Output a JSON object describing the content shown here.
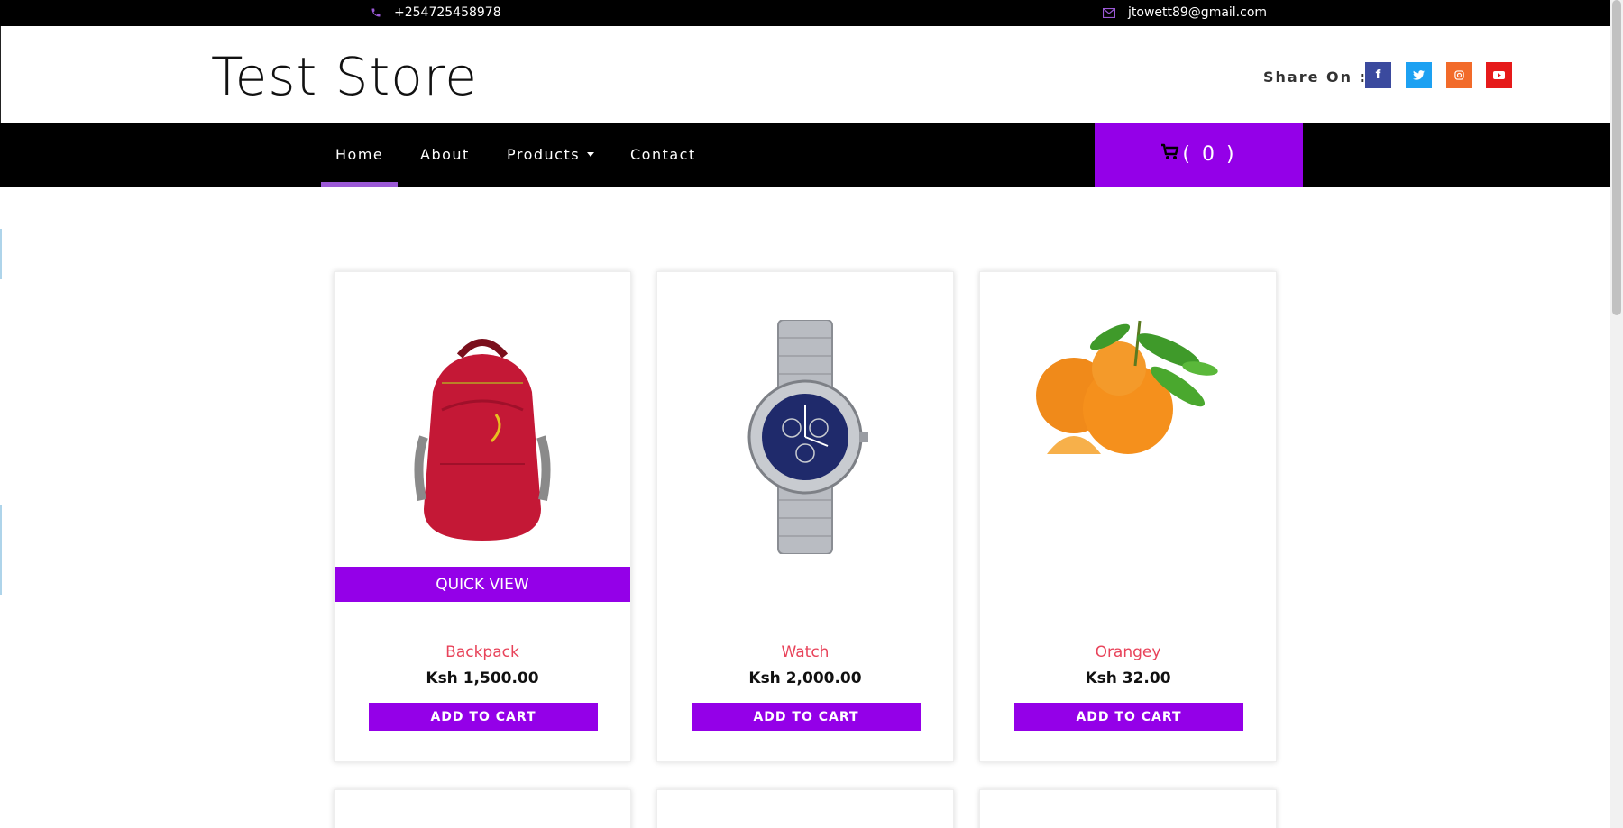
{
  "topbar": {
    "phone": "+254725458978",
    "email": "jtowett89@gmail.com"
  },
  "header": {
    "logo": "Test Store",
    "share_label": "Share On :",
    "social": [
      "facebook-icon",
      "twitter-icon",
      "instagram-icon",
      "youtube-icon"
    ]
  },
  "nav": {
    "items": [
      {
        "label": "Home",
        "active": true
      },
      {
        "label": "About"
      },
      {
        "label": "Products"
      },
      {
        "label": "Contact"
      }
    ],
    "cart_label": "( 0 )"
  },
  "products": [
    {
      "name": "Backpack",
      "price": "Ksh 1,500.00",
      "quick_view": "QUICK VIEW",
      "add_label": "ADD TO CART",
      "icon": "backpack-image"
    },
    {
      "name": "Watch",
      "price": "Ksh 2,000.00",
      "add_label": "ADD TO CART",
      "icon": "watch-image"
    },
    {
      "name": "Orangey",
      "price": "Ksh 32.00",
      "add_label": "ADD TO CART",
      "icon": "oranges-image"
    }
  ],
  "colors": {
    "accent": "#9400e8",
    "product_name": "#e8435a",
    "nav_bg": "#000000",
    "active_underline": "#9b59d6"
  }
}
